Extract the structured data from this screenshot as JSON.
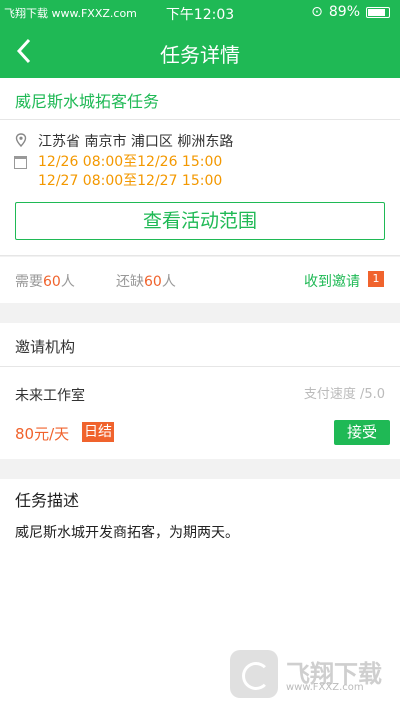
{
  "status_bar": {
    "left_text": "飞翔下载 www.FXXZ.com",
    "time": "下午12:03",
    "battery": "89%"
  },
  "nav": {
    "back_icon": "chevron-left-icon",
    "title": "任务详情"
  },
  "task": {
    "title": "威尼斯水城拓客任务",
    "address": "江苏省 南京市 浦口区 柳洲东路",
    "time_1": "12/26 08:00至12/26 15:00",
    "time_2": "12/27 08:00至12/27 15:00",
    "range_button": "查看活动范围"
  },
  "stats": {
    "need_label": "需要",
    "need_count": "60",
    "need_unit": "人",
    "short_label": "还缺",
    "short_count": "60",
    "short_unit": "人",
    "invite_label": "收到邀请",
    "invite_count": "1"
  },
  "org_section": {
    "heading": "邀请机构",
    "name": "未来工作室",
    "speed": "支付速度 /5.0",
    "price": "80元/天",
    "settle_tag": "日结",
    "accept_button": "接受"
  },
  "description": {
    "heading": "任务描述",
    "text": "威尼斯水城开发商拓客，为期两天。"
  },
  "watermark": {
    "text": "飞翔下载",
    "url": "www.FXXZ.com"
  },
  "colors": {
    "primary": "#1fb955",
    "accent": "#f0632d",
    "time": "#f39800"
  }
}
